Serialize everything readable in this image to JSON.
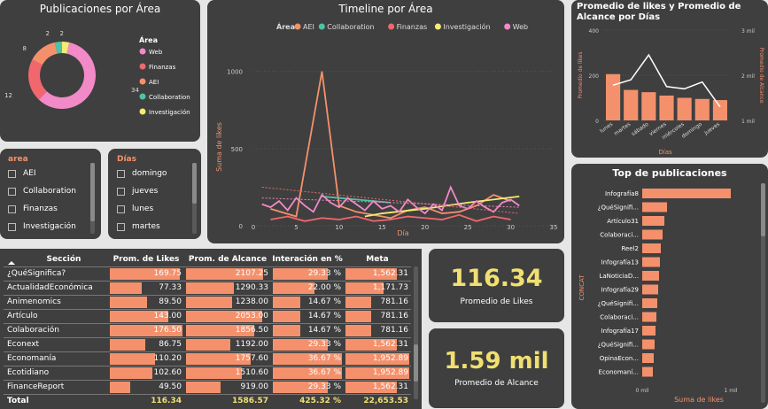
{
  "colors": {
    "accent": "#f4916c",
    "web": "#f28ac8",
    "finanzas": "#f0686d",
    "aei": "#f4916c",
    "collaboration": "#4fc2a4",
    "investigacion": "#f4ea74",
    "kpi": "#f1e070",
    "panel": "#3f3f3f"
  },
  "donut": {
    "title": "Publicaciones por Área",
    "legend_title": "Área",
    "chart_data": {
      "type": "pie",
      "labels": [
        "Web",
        "Finanzas",
        "AEI",
        "Collaboration",
        "Investigación"
      ],
      "values": [
        34,
        12,
        8,
        2,
        2
      ],
      "value_labels": [
        "34",
        "12",
        "8",
        "2",
        "2"
      ]
    }
  },
  "timeline": {
    "title": "Timeline por Área",
    "legend_title": "Área",
    "xlabel": "Día",
    "ylabel": "Suma de likes",
    "chart_data": {
      "type": "line",
      "xlim": [
        0,
        35
      ],
      "ylim": [
        0,
        1050
      ],
      "xticks": [
        "0",
        "5",
        "10",
        "15",
        "20",
        "25",
        "30",
        "35"
      ],
      "yticks": [
        "0",
        "500",
        "1000"
      ],
      "series": [
        {
          "name": "AEI",
          "x": [
            2,
            5,
            8,
            10,
            12,
            14,
            16,
            18,
            20,
            22,
            24,
            26,
            28,
            30
          ],
          "y": [
            110,
            60,
            1000,
            130,
            90,
            70,
            50,
            100,
            120,
            80,
            90,
            130,
            200,
            160
          ]
        },
        {
          "name": "Collaboration",
          "x": [
            8,
            12,
            16
          ],
          "y": [
            190,
            170,
            150
          ]
        },
        {
          "name": "Finanzas",
          "x": [
            2,
            4,
            6,
            8,
            10,
            12,
            14,
            16,
            18,
            20,
            22,
            24,
            26,
            28,
            30
          ],
          "y": [
            40,
            60,
            30,
            50,
            40,
            60,
            30,
            40,
            60,
            50,
            40,
            70,
            30,
            60,
            40
          ]
        },
        {
          "name": "Investigación",
          "x": [
            13,
            15,
            20,
            25,
            31
          ],
          "y": [
            60,
            80,
            110,
            150,
            190
          ]
        },
        {
          "name": "Web",
          "x": [
            1,
            2,
            3,
            4,
            5,
            6,
            7,
            8,
            9,
            10,
            11,
            12,
            13,
            14,
            15,
            16,
            17,
            18,
            19,
            20,
            21,
            22,
            23,
            24,
            25,
            26,
            27,
            28,
            29,
            30,
            31
          ],
          "y": [
            140,
            120,
            160,
            100,
            180,
            130,
            90,
            200,
            150,
            120,
            180,
            140,
            100,
            160,
            110,
            130,
            90,
            170,
            120,
            80,
            140,
            100,
            250,
            130,
            110,
            160,
            120,
            90,
            150,
            170,
            130
          ]
        }
      ]
    }
  },
  "combo": {
    "title": "Promedio de likes y Promedio de Alcance por Días",
    "xlabel": "Días",
    "ylabel_left": "Promedio de likes",
    "ylabel_right": "Promedio de Alcance",
    "chart_data": {
      "type": "bar",
      "categories": [
        "lunes",
        "martes",
        "sábado",
        "viernes",
        "miércoles",
        "domingo",
        "jueves"
      ],
      "series": [
        {
          "name": "Promedio de likes",
          "values": [
            205,
            135,
            125,
            110,
            100,
            95,
            90
          ]
        },
        {
          "name": "Promedio de Alcance",
          "values": [
            1780,
            1900,
            2450,
            1750,
            1700,
            1850,
            1300
          ]
        }
      ],
      "ylim_left": [
        0,
        400
      ],
      "ylim_right": [
        1000,
        3000
      ],
      "yticks_left": [
        "0",
        "200",
        "400"
      ],
      "yticks_right": [
        "1 mil",
        "2 mil",
        "3 mil"
      ]
    }
  },
  "slicer_area": {
    "title": "area",
    "items": [
      "AEI",
      "Collaboration",
      "Finanzas",
      "Investigación"
    ]
  },
  "slicer_dias": {
    "title": "Días",
    "items": [
      "domingo",
      "jueves",
      "lunes",
      "martes"
    ]
  },
  "table": {
    "headers": [
      "Sección",
      "Prom. de Likes",
      "Prom. de Alcance",
      "Interación en %",
      "Meta"
    ],
    "rows": [
      [
        "¿QuéSignifica?",
        "169.75",
        "2107.25",
        "29.33 %",
        "1,562.31"
      ],
      [
        "ActualidadEconómica",
        "77.33",
        "1290.33",
        "22.00 %",
        "1,171.73"
      ],
      [
        "Animenomics",
        "89.50",
        "1238.00",
        "14.67 %",
        "781.16"
      ],
      [
        "Artículo",
        "143.00",
        "2053.00",
        "14.67 %",
        "781.16"
      ],
      [
        "Colaboración",
        "176.50",
        "1856.50",
        "14.67 %",
        "781.16"
      ],
      [
        "Econext",
        "86.75",
        "1192.00",
        "29.33 %",
        "1,562.31"
      ],
      [
        "Economanía",
        "110.20",
        "1757.60",
        "36.67 %",
        "1,952.89"
      ],
      [
        "Ecotidiano",
        "102.60",
        "1510.60",
        "36.67 %",
        "1,952.89"
      ],
      [
        "FinanceReport",
        "49.50",
        "919.00",
        "29.33 %",
        "1,562.31"
      ]
    ],
    "fractions": [
      [
        0.96,
        0.93,
        0.8,
        0.8
      ],
      [
        0.44,
        0.57,
        0.6,
        0.6
      ],
      [
        0.51,
        0.55,
        0.4,
        0.4
      ],
      [
        0.81,
        0.91,
        0.4,
        0.4
      ],
      [
        1.0,
        0.82,
        0.4,
        0.4
      ],
      [
        0.49,
        0.53,
        0.8,
        0.8
      ],
      [
        0.62,
        0.78,
        1.0,
        1.0
      ],
      [
        0.58,
        0.67,
        1.0,
        1.0
      ],
      [
        0.28,
        0.41,
        0.8,
        0.8
      ]
    ],
    "total": [
      "Total",
      "116.34",
      "1586.57",
      "425.32 %",
      "22,653.53"
    ]
  },
  "kpi_likes": {
    "value": "116.34",
    "label": "Promedio de Likes"
  },
  "kpi_alcance": {
    "value": "1.59 mil",
    "label": "Promedio de Alcance"
  },
  "top": {
    "title": "Top de publicaciones",
    "xlabel": "Suma de likes",
    "ylabel": "CONCAT",
    "chart_data": {
      "type": "bar",
      "categories": [
        "Infografía8",
        "¿QuéSignifi...",
        "Artículo31",
        "Colaboraci...",
        "Reel2",
        "Infografía13",
        "LaNoticiaD...",
        "Infografía29",
        "¿QuéSignifi...",
        "Colaboraci...",
        "Infografía17",
        "¿QuéSignifi...",
        "OpinaEcon...",
        "Economaní..."
      ],
      "values": [
        1000,
        280,
        250,
        230,
        210,
        200,
        190,
        180,
        170,
        160,
        150,
        140,
        130,
        120
      ],
      "xlim": [
        0,
        1200
      ],
      "xticks": [
        "0 mil",
        "1 mil"
      ]
    }
  }
}
